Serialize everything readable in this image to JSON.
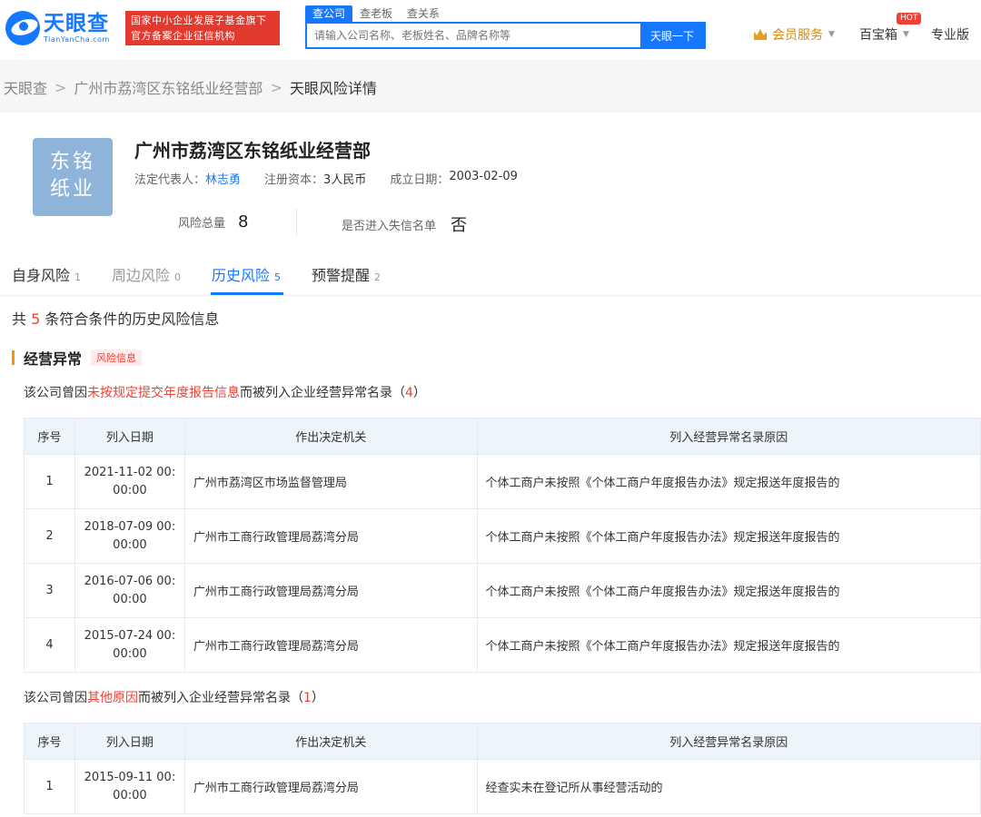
{
  "header": {
    "logo_cn": "天眼查",
    "logo_en": "TianYanCha.com",
    "banner_line1": "国家中小企业发展子基金旗下",
    "banner_line2": "官方备案企业征信机构",
    "search_tabs": [
      "查公司",
      "查老板",
      "查关系"
    ],
    "search_placeholder": "请输入公司名称、老板姓名、品牌名称等",
    "search_button": "天眼一下",
    "member_label": "会员服务",
    "toolbox_label": "百宝箱",
    "hot_badge": "HOT",
    "pro_label": "专业版"
  },
  "breadcrumb": [
    "天眼查",
    "广州市荔湾区东铭纸业经营部",
    "天眼风险详情"
  ],
  "company": {
    "logo_line1": "东铭",
    "logo_line2": "纸业",
    "name": "广州市荔湾区东铭纸业经营部",
    "legal_rep_label": "法定代表人：",
    "legal_rep": "林志勇",
    "capital_label": "注册资本：",
    "capital": "3人民币",
    "founded_label": "成立日期：",
    "founded": "2003-02-09",
    "risk_total_label": "风险总量",
    "risk_total": "8",
    "blacklist_label": "是否进入失信名单",
    "blacklist": "否"
  },
  "tabs": [
    {
      "label": "自身风险",
      "count": "1"
    },
    {
      "label": "周边风险",
      "count": "0"
    },
    {
      "label": "历史风险",
      "count": "5"
    },
    {
      "label": "预警提醒",
      "count": "2"
    }
  ],
  "summary": {
    "prefix": "共 ",
    "count": "5",
    "suffix": " 条符合条件的历史风险信息"
  },
  "section": {
    "title": "经营异常",
    "tag": "风险信息"
  },
  "group1": {
    "prefix": "该公司曾因",
    "highlight": "未按规定提交年度报告信息",
    "suffix": "而被列入企业经营异常名录（",
    "count": "4",
    "close": "）"
  },
  "group2": {
    "prefix": "该公司曾因",
    "highlight": "其他原因",
    "suffix": "而被列入企业经营异常名录（",
    "count": "1",
    "close": "）"
  },
  "table_headers": [
    "序号",
    "列入日期",
    "作出决定机关",
    "列入经营异常名录原因"
  ],
  "table1_rows": [
    {
      "no": "1",
      "date1": "2021-11-02 00:",
      "date2": "00:00",
      "authority": "广州市荔湾区市场监督管理局",
      "reason": "个体工商户未按照《个体工商户年度报告办法》规定报送年度报告的"
    },
    {
      "no": "2",
      "date1": "2018-07-09 00:",
      "date2": "00:00",
      "authority": "广州市工商行政管理局荔湾分局",
      "reason": "个体工商户未按照《个体工商户年度报告办法》规定报送年度报告的"
    },
    {
      "no": "3",
      "date1": "2016-07-06 00:",
      "date2": "00:00",
      "authority": "广州市工商行政管理局荔湾分局",
      "reason": "个体工商户未按照《个体工商户年度报告办法》规定报送年度报告的"
    },
    {
      "no": "4",
      "date1": "2015-07-24 00:",
      "date2": "00:00",
      "authority": "广州市工商行政管理局荔湾分局",
      "reason": "个体工商户未按照《个体工商户年度报告办法》规定报送年度报告的"
    }
  ],
  "table2_rows": [
    {
      "no": "1",
      "date1": "2015-09-11 00:",
      "date2": "00:00",
      "authority": "广州市工商行政管理局荔湾分局",
      "reason": "经查实未在登记所从事经营活动的"
    }
  ],
  "colors": {
    "brand": "#1677ff",
    "danger": "#f04134",
    "accent": "#f39800"
  }
}
